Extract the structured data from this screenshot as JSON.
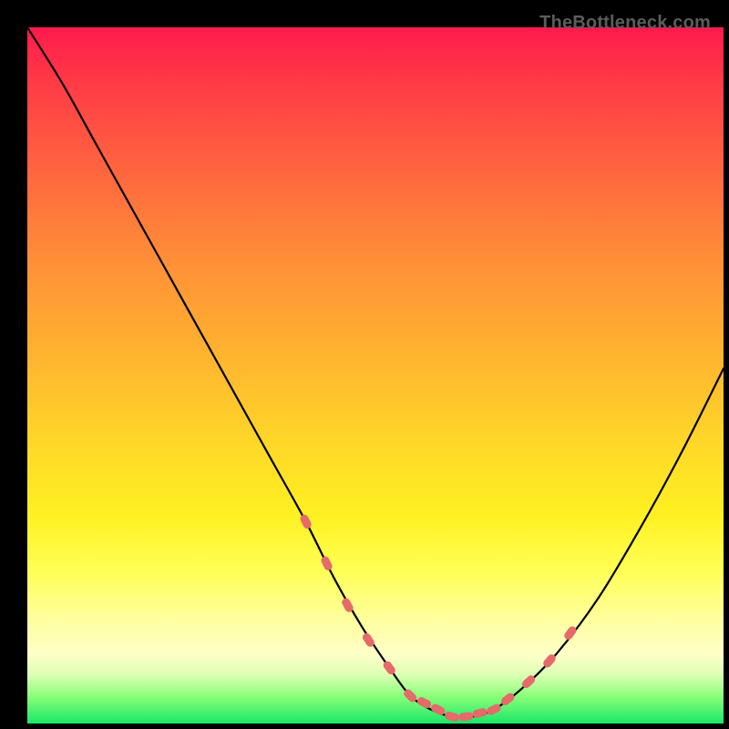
{
  "watermark": "TheBottleneck.com",
  "colors": {
    "curve_stroke": "#000000",
    "dot_fill": "#e56a6a",
    "dot_stroke": "#d05858",
    "green_line": "#19e868"
  },
  "chart_data": {
    "type": "line",
    "title": "",
    "xlabel": "",
    "ylabel": "",
    "xrange": [
      0,
      100
    ],
    "yrange": [
      0,
      100
    ],
    "series": [
      {
        "name": "bottleneck-curve",
        "x": [
          0,
          5,
          10,
          15,
          20,
          25,
          30,
          35,
          40,
          44,
          48,
          52,
          55,
          58,
          61,
          64,
          67,
          71,
          76,
          82,
          88,
          94,
          100
        ],
        "y": [
          100,
          92,
          83,
          74,
          65,
          56,
          47,
          38,
          29,
          21,
          14,
          8,
          4,
          2,
          1,
          1,
          2,
          5,
          10,
          18,
          28,
          39,
          51
        ]
      }
    ],
    "dots_segment": {
      "name": "highlight-dots",
      "x": [
        40,
        43,
        46,
        49,
        52,
        55,
        57,
        59,
        61,
        63,
        65,
        67,
        69,
        72,
        75,
        78
      ],
      "y": [
        29,
        23,
        17,
        12,
        8,
        4,
        3,
        2,
        1,
        1,
        1.5,
        2,
        3.5,
        6,
        9,
        13
      ]
    },
    "gradient_stops": [
      {
        "pos": 0,
        "color": "#ff1a4d"
      },
      {
        "pos": 22,
        "color": "#ff6a3e"
      },
      {
        "pos": 48,
        "color": "#ffb62f"
      },
      {
        "pos": 70,
        "color": "#fff021"
      },
      {
        "pos": 90,
        "color": "#ffffc8"
      },
      {
        "pos": 100,
        "color": "#19e868"
      }
    ]
  }
}
